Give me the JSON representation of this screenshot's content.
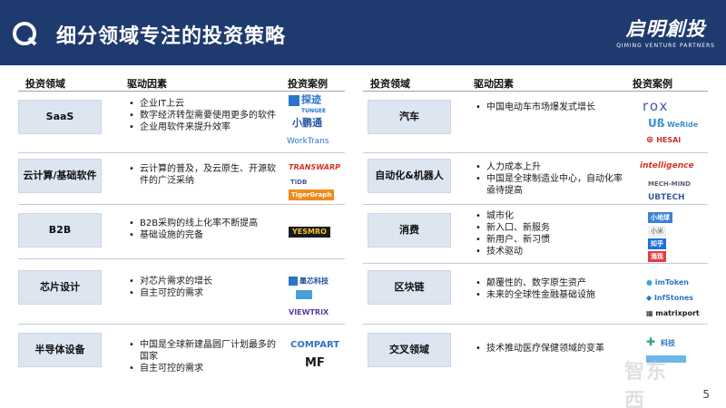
{
  "header": {
    "title": "细分领域专注的投资策略",
    "brand_cn": "启明創投",
    "brand_en": "QIMING VENTURE PARTNERS"
  },
  "columns": {
    "field": "投资领域",
    "drivers": "驱动因素",
    "cases": "投资案例"
  },
  "left_rows": [
    {
      "field": "SaaS",
      "drivers": [
        "企业IT上云",
        "数字经济转型需要使用更多的软件",
        "企业用软件来提升效率"
      ]
    },
    {
      "field": "云计算/基础软件",
      "drivers": [
        "云计算的普及，及云原生、开源软件的广泛采纳"
      ]
    },
    {
      "field": "B2B",
      "drivers": [
        "B2B采购的线上化率不断提高",
        "基础设施的完备"
      ]
    },
    {
      "field": "芯片设计",
      "drivers": [
        "对芯片需求的增长",
        "自主可控的需求"
      ]
    },
    {
      "field": "半导体设备",
      "drivers": [
        "中国是全球新建晶圆厂计划最多的国家",
        "自主可控的需求"
      ]
    }
  ],
  "right_rows": [
    {
      "field": "汽车",
      "drivers": [
        "中国电动车市场爆发式增长"
      ]
    },
    {
      "field": "自动化&机器人",
      "drivers": [
        "人力成本上升",
        "中国是全球制造业中心，自动化率亟待提高"
      ]
    },
    {
      "field": "消费",
      "drivers": [
        "城市化",
        "新入口、新服务",
        "新用户、新习惯",
        "技术驱动"
      ]
    },
    {
      "field": "区块链",
      "drivers": [
        "颠覆性的、数字原生资产",
        "未来的全球性金融基础设施"
      ]
    },
    {
      "field": "交叉领域",
      "drivers": [
        "技术推动医疗保健领域的变革"
      ]
    }
  ],
  "logos": {
    "tungee": "探迹",
    "tungee_en": "TUNGEE",
    "xiaopengtong": "小鹏通",
    "worktrans": "WorkTrans",
    "transwarp": "TRANSWARP",
    "tigergraph": "TigerGraph",
    "yesmro": "YESMRO",
    "chip1": "墨芯科技",
    "viewtrix": "VIEWTRIX",
    "compart": "COMPART",
    "mt": "MF",
    "rox": "rox",
    "weride": "WeRide",
    "hesai": "HESAI",
    "intelligence": "intelligence",
    "mech_mind": "MECH-MIND",
    "ubtech": "UBTECH",
    "xiaohongshu": "小红书",
    "zhihu": "知乎",
    "imtoken": "imToken",
    "infstones": "InfStones",
    "matrixport": "matrixport"
  },
  "watermark": "智东西",
  "page_number": "5",
  "colors": {
    "header_bg": "#1f3a6e",
    "label_bg": "#dde5f1"
  }
}
